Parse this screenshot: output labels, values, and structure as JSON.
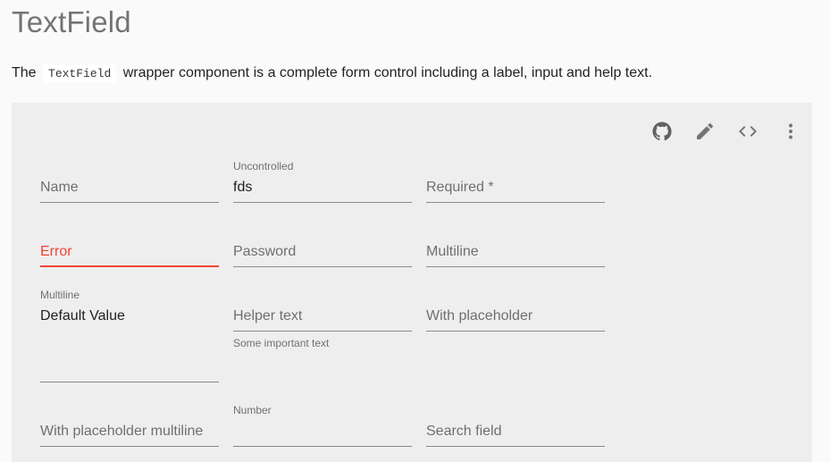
{
  "page": {
    "title": "TextField",
    "intro_before": "The",
    "intro_code": "TextField",
    "intro_after": "wrapper component is a complete form control including a label, input and help text."
  },
  "toolbar": {
    "icons": [
      "github-icon",
      "edit-icon",
      "code-icon",
      "more-vert-icon"
    ]
  },
  "fields": {
    "name": {
      "label": "Name"
    },
    "uncontrolled": {
      "label": "Uncontrolled",
      "value": "fds"
    },
    "required": {
      "label": "Required *"
    },
    "error": {
      "label": "Error"
    },
    "password": {
      "label": "Password"
    },
    "multiline": {
      "label": "Multiline"
    },
    "multiline_default": {
      "label": "Multiline",
      "value": "Default Value"
    },
    "helper": {
      "label": "Helper text",
      "helper": "Some important text"
    },
    "with_placeholder": {
      "label": "With placeholder"
    },
    "placeholder_multiline": {
      "label": "With placeholder multiline"
    },
    "number": {
      "label": "Number"
    },
    "search": {
      "label": "Search field"
    }
  },
  "colors": {
    "error": "#f44336",
    "demo_background": "#eeeeee",
    "page_background": "#fafafa"
  }
}
